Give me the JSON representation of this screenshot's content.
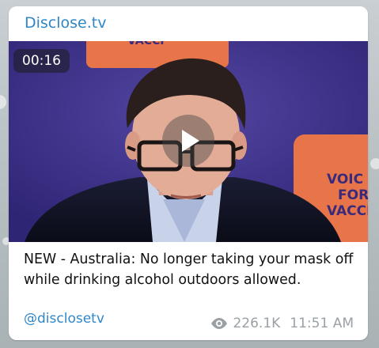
{
  "post": {
    "channel_name": "Disclose.tv",
    "video_duration": "00:16",
    "caption": "NEW - Australia: No longer taking your mask off while drinking alcohol outdoors allowed.",
    "handle": "@disclosetv",
    "views": "226.1K",
    "time": "11:51 AM"
  },
  "video_frame": {
    "sign_text_top": "VACCI",
    "sign_text_right": [
      "VOIC",
      "FOR",
      "VACCI"
    ]
  },
  "icons": {
    "play": "play-icon",
    "views": "eye-icon"
  },
  "colors": {
    "link": "#2f86c7",
    "meta_text": "#9aa1a6",
    "card_bg": "#ffffff",
    "video_bg": "#41338f",
    "sign_orange": "#e8744a"
  }
}
